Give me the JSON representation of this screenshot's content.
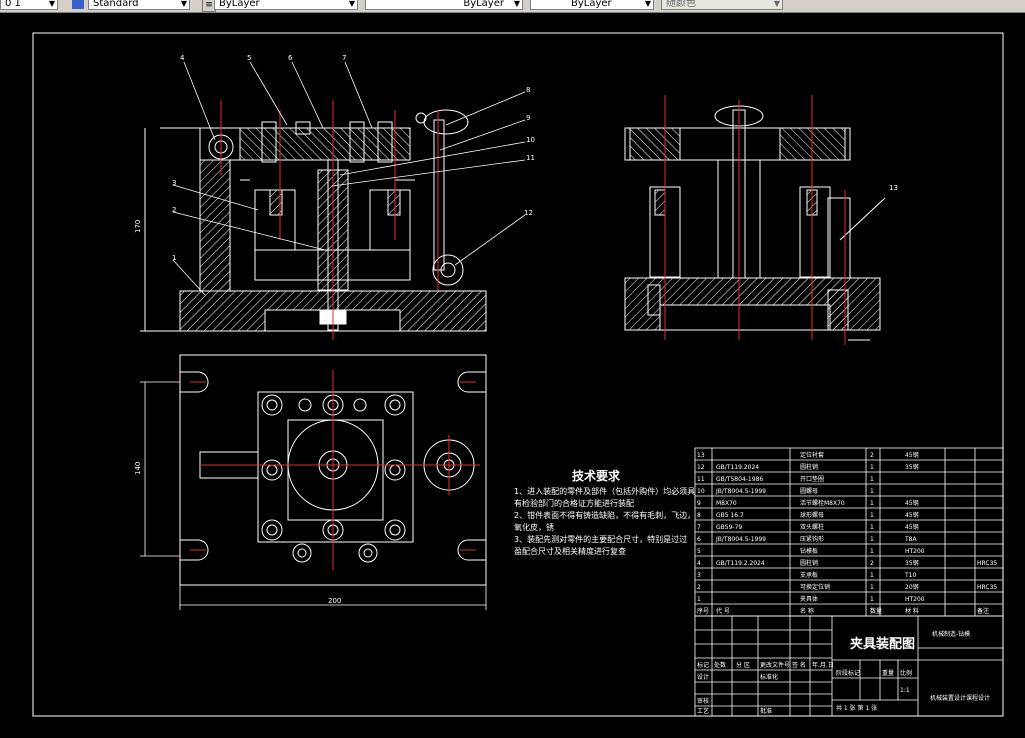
{
  "toolbar": {
    "layer": "0 1",
    "textstyle": "Standard",
    "color": "ByLayer",
    "linetype": "ByLayer",
    "lineweight": "ByLayer",
    "plotstyle": "随颜色"
  },
  "drawing": {
    "part_numbers": [
      "4",
      "5",
      "6",
      "7",
      "8",
      "9",
      "10",
      "11",
      "3",
      "2",
      "1",
      "12",
      "13"
    ],
    "dimensions": {
      "height_front": "170",
      "height_top": "140",
      "width_top": "200"
    },
    "tech_requirements": {
      "title": "技术要求",
      "lines": [
        "1、进入装配的零件及部件（包括外购件）均必须具",
        "有检验部门的合格证方能进行装配",
        "2、钳件表面不得有铸造缺陷，不得有毛刺，飞边，",
        "氧化皮，锈",
        "3、装配先测对零件的主要配合尺寸，特别是过过",
        "盈配合尺寸及相关精度进行复查"
      ]
    },
    "bom": {
      "rows": [
        {
          "no": "13",
          "code": "",
          "name": "定位衬套",
          "qty": "2",
          "material": "45钢",
          "note": ""
        },
        {
          "no": "12",
          "code": "GB/T119.2024",
          "name": "圆柱销",
          "qty": "1",
          "material": "35钢",
          "note": ""
        },
        {
          "no": "11",
          "code": "GB/T5804-1986",
          "name": "开口垫圈",
          "qty": "1",
          "material": "",
          "note": ""
        },
        {
          "no": "10",
          "code": "JB/T8004.5-1999",
          "name": "圆螺母",
          "qty": "1",
          "material": "",
          "note": ""
        },
        {
          "no": "9",
          "code": "M8X70",
          "name": "活节螺栓M8X70",
          "qty": "1",
          "material": "45钢",
          "note": ""
        },
        {
          "no": "8",
          "code": "GB5 16.7",
          "name": "球形螺母",
          "qty": "1",
          "material": "45钢",
          "note": ""
        },
        {
          "no": "7",
          "code": "GB59-79",
          "name": "双头螺柱",
          "qty": "1",
          "material": "45钢",
          "note": ""
        },
        {
          "no": "6",
          "code": "JB/T8004.5-1999",
          "name": "压紧钩形",
          "qty": "1",
          "material": "T8A",
          "note": ""
        },
        {
          "no": "5",
          "code": "",
          "name": "钻模板",
          "qty": "1",
          "material": "HT200",
          "note": ""
        },
        {
          "no": "4",
          "code": "GB/T119.2.2024",
          "name": "圆柱销",
          "qty": "2",
          "material": "35钢",
          "note": "HRC35"
        },
        {
          "no": "3",
          "code": "",
          "name": "支承板",
          "qty": "1",
          "material": "T10",
          "note": ""
        },
        {
          "no": "2",
          "code": "",
          "name": "可换定位销",
          "qty": "1",
          "material": "20钢",
          "note": "HRC35"
        },
        {
          "no": "1",
          "code": "",
          "name": "夹具体",
          "qty": "1",
          "material": "HT200",
          "note": ""
        }
      ],
      "header": {
        "no": "序号",
        "code": "代 号",
        "name": "名 称",
        "qty": "数量",
        "material": "材 料",
        "note": "备注"
      }
    },
    "title_block": {
      "title": "夹具装配图",
      "drawing_no": "机械制造-钻模",
      "scale": "1:1",
      "sheets": "共 1 张  第 1 张",
      "company": "机械装置设计课程设计",
      "labels": {
        "marks": "标记",
        "count": "处数",
        "zone": "分 区",
        "doc": "更改文件号",
        "sign": "签 名",
        "date": "年.月.日",
        "design": "设计",
        "std": "标准化",
        "review": "审核",
        "process": "工艺",
        "approve": "批准",
        "stage": "阶段标记",
        "weight": "重量",
        "ratio": "比例"
      }
    }
  }
}
